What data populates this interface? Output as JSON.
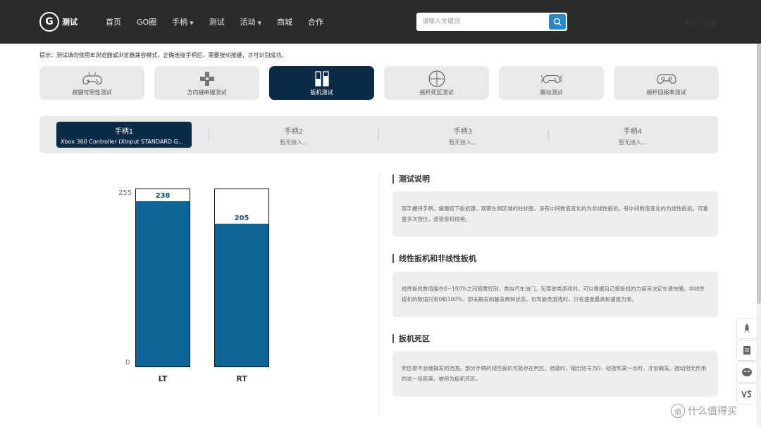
{
  "header": {
    "logo_mark": "G",
    "logo_text": "测试",
    "nav": [
      {
        "label": "首页",
        "dropdown": false
      },
      {
        "label": "GO圈",
        "dropdown": false
      },
      {
        "label": "手柄",
        "dropdown": true
      },
      {
        "label": "测试",
        "dropdown": false
      },
      {
        "label": "活动",
        "dropdown": true
      },
      {
        "label": "商城",
        "dropdown": false
      },
      {
        "label": "合作",
        "dropdown": false
      }
    ],
    "search_placeholder": "请输入关键词",
    "search_icon": "search-icon",
    "login_text": "登录 | 注册"
  },
  "tip": "提示：测试请勿使用IE浏览器或浏览器兼容模式，正确连接手柄后，需要按动按键，才可识别成功。",
  "test_modes": [
    {
      "label": "按键可用性测试",
      "icon": "gamepad-icon",
      "active": false
    },
    {
      "label": "方向键串键测试",
      "icon": "dpad-icon",
      "active": false
    },
    {
      "label": "扳机测试",
      "icon": "trigger-icon",
      "active": true
    },
    {
      "label": "摇杆死区测试",
      "icon": "crosshair-icon",
      "active": false
    },
    {
      "label": "震动测试",
      "icon": "vibration-icon",
      "active": false
    },
    {
      "label": "摇杆回报率测试",
      "icon": "gamepad-icon",
      "active": false
    }
  ],
  "controllers": [
    {
      "label": "手柄1",
      "status": "Xbox 360 Controller (XInput STANDARD GAMEPAD)",
      "active": true
    },
    {
      "label": "手柄2",
      "status": "暂无接入...",
      "active": false
    },
    {
      "label": "手柄3",
      "status": "暂无接入...",
      "active": false
    },
    {
      "label": "手柄4",
      "status": "暂无接入...",
      "active": false
    }
  ],
  "chart_data": {
    "type": "bar",
    "categories": [
      "LT",
      "RT"
    ],
    "values": [
      238,
      205
    ],
    "ylim": [
      0,
      255
    ],
    "y_ticks": [
      "255",
      "0"
    ],
    "bar_color": "#0f6496"
  },
  "sections": [
    {
      "title": "测试说明",
      "text": "双手握持手柄，缓慢按下扳机键，观察左侧区域的柱状图，没有中间数值变化的为非线性扳机，有中间数值变化的为线性扳机，可重复多次按压，感受扳机线程。"
    },
    {
      "title": "线性扳机和非线性扳机",
      "text": "线性扳机数值能在0~100%之间随意控制，类似汽车油门。玩驾驶类游戏时，可以根据自己按扳机的力度来决定车速快慢。非线性扳机的数值只有0和100%，即未触发和触发两种状态。玩驾驶类游戏时，只有速度最高和速度为零。"
    },
    {
      "title": "扳机死区",
      "text": "死区即不会被触发的范围。部分手柄的线性扳机可能存在死区，轻按时，输出信号为0，轻按到某一点时，才会触发。按动但无作用的这一段距离，被称为扳机死区。"
    }
  ],
  "float_icons": [
    "rocket-icon",
    "note-icon",
    "chat-icon",
    "versus-icon"
  ],
  "watermark": "什么值得买",
  "watermark_mark": "值",
  "colors": {
    "header_bg": "#2b2b2b",
    "active_navy": "#0c2b49",
    "search_button": "#2a86c8"
  }
}
